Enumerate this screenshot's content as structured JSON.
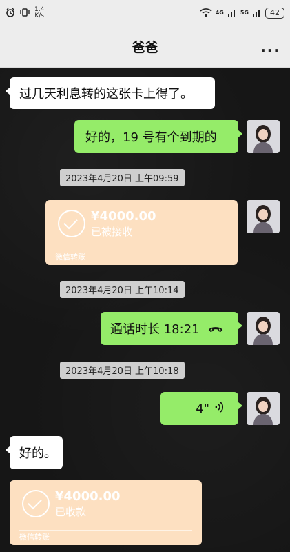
{
  "status_bar": {
    "speed_value": "1.4",
    "speed_unit": "K/s",
    "net1": "4G",
    "net2": "5G",
    "battery": "42"
  },
  "header": {
    "title": "爸爸",
    "more": "..."
  },
  "messages": {
    "m1": "过几天利息转的这张卡上得了。",
    "m2": "好的，19 号有个到期的",
    "ts1": "2023年4月20日 上午09:59",
    "t1_amount": "¥4000.00",
    "t1_status": "已被接收",
    "t1_footer": "微信转账",
    "ts2": "2023年4月20日 上午10:14",
    "call": "通话时长 18:21",
    "ts3": "2023年4月20日 上午10:18",
    "voice": "4\"",
    "m3": "好的。",
    "t2_amount": "¥4000.00",
    "t2_status": "已收款",
    "t2_footer": "微信转账"
  }
}
